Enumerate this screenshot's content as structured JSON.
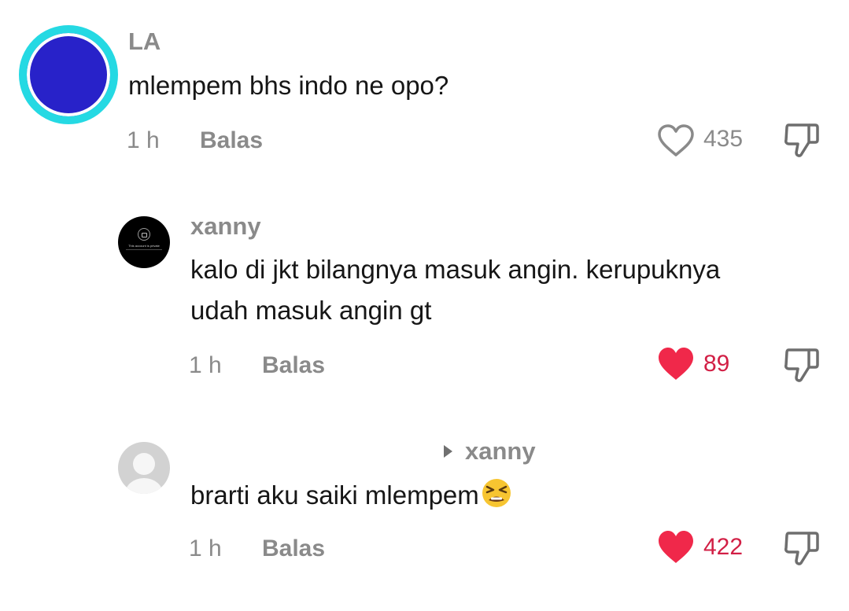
{
  "comments": [
    {
      "username": "LA",
      "text": "mlempem bhs indo ne opo?",
      "time": "1 h",
      "reply_label": "Balas",
      "like_count": "435",
      "liked": false,
      "avatar": "blue-circle-avatar"
    },
    {
      "username": "xanny",
      "text_line1": "kalo di jkt bilangnya masuk angin. kerupuknya",
      "text_line2": "udah masuk angin gt",
      "time": "1 h",
      "reply_label": "Balas",
      "like_count": "89",
      "liked": true,
      "avatar": "private-account-avatar"
    },
    {
      "username": "",
      "reply_to": "xanny",
      "text": "brarti aku saiki mlempem",
      "emoji": "tired-face-emoji",
      "time": "1 h",
      "reply_label": "Balas",
      "like_count": "422",
      "liked": true,
      "avatar": "default-avatar"
    }
  ],
  "avatar_private_caption": "This account is private",
  "colors": {
    "liked_heart": "#f0284a",
    "liked_count": "#d21f45",
    "muted_text": "#8a8a8a",
    "body_text": "#161616",
    "avatar_ring": "#25d9e3",
    "avatar_fill": "#2822c9"
  }
}
